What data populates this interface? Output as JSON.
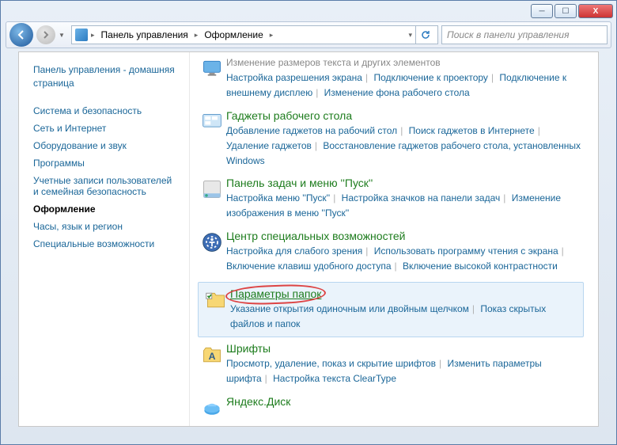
{
  "titlebar": {
    "minimize": "─",
    "maximize": "☐",
    "close": "X"
  },
  "address": {
    "crumb1": "Панель управления",
    "crumb2": "Оформление"
  },
  "search": {
    "placeholder": "Поиск в панели управления"
  },
  "sidebar": {
    "home": "Панель управления - домашняя страница",
    "items": [
      "Система и безопасность",
      "Сеть и Интернет",
      "Оборудование и звук",
      "Программы",
      "Учетные записи пользователей и семейная безопасность",
      "Оформление",
      "Часы, язык и регион",
      "Специальные возможности"
    ]
  },
  "top_partial": {
    "line1": "Изменение размеров текста и других элементов",
    "links": [
      "Настройка разрешения экрана",
      "Подключение к проектору",
      "Подключение к внешнему дисплею",
      "Изменение фона рабочего стола"
    ]
  },
  "cat_gadgets": {
    "title": "Гаджеты рабочего стола",
    "links": [
      "Добавление гаджетов на рабочий стол",
      "Поиск гаджетов в Интернете",
      "Удаление гаджетов",
      "Восстановление гаджетов рабочего стола, установленных Windows"
    ]
  },
  "cat_taskbar": {
    "title": "Панель задач и меню ''Пуск''",
    "links": [
      "Настройка меню ''Пуск''",
      "Настройка значков на панели задач",
      "Изменение изображения в меню ''Пуск''"
    ]
  },
  "cat_ease": {
    "title": "Центр специальных возможностей",
    "links": [
      "Настройка для слабого зрения",
      "Использовать программу чтения с экрана",
      "Включение клавиш удобного доступа",
      "Включение высокой контрастности"
    ]
  },
  "cat_folders": {
    "title": "Параметры папок",
    "links": [
      "Указание открытия одиночным или двойным щелчком",
      "Показ скрытых файлов и папок"
    ]
  },
  "cat_fonts": {
    "title": "Шрифты",
    "links": [
      "Просмотр, удаление, показ и скрытие шрифтов",
      "Изменить параметры шрифта",
      "Настройка текста ClearType"
    ]
  },
  "cat_yandex": {
    "title": "Яндекс.Диск"
  }
}
